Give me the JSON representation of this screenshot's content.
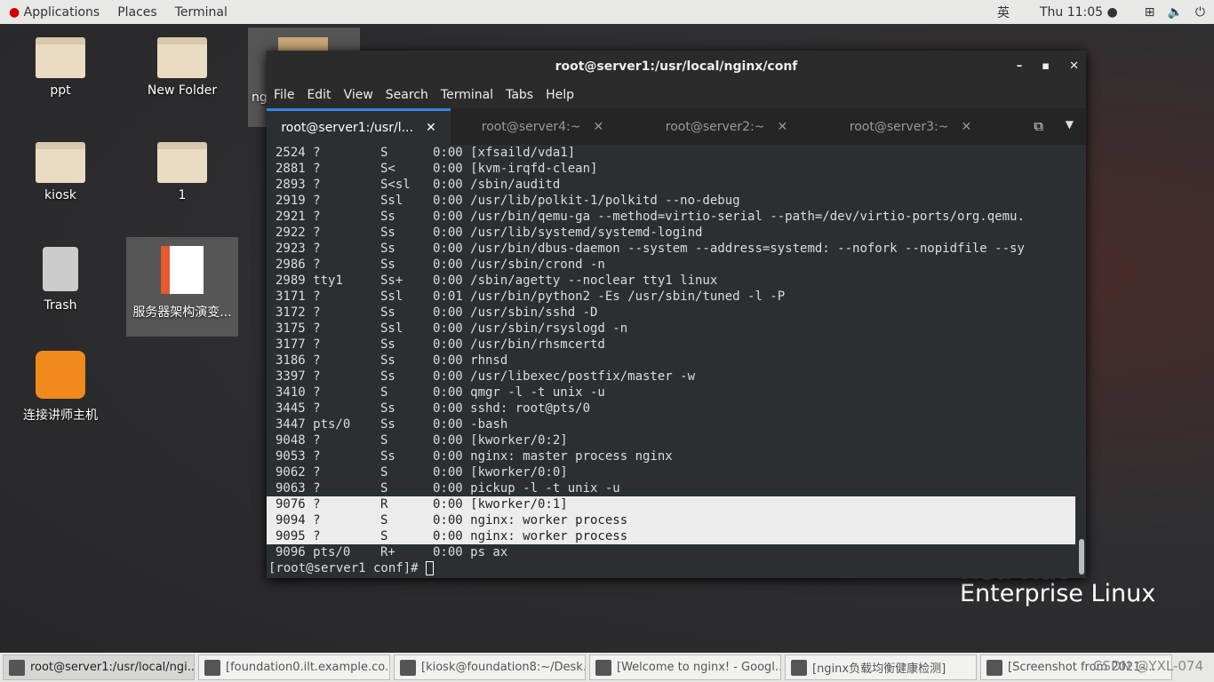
{
  "topbar": {
    "applications": "Applications",
    "places": "Places",
    "terminal": "Terminal",
    "input_method": "英",
    "clock": "Thu 11:05 ●"
  },
  "desktop": [
    {
      "label": "ppt"
    },
    {
      "label": "New Folder"
    },
    {
      "label": "ng"
    },
    {
      "label": "kiosk"
    },
    {
      "label": "1"
    },
    {
      "label": "Trash"
    },
    {
      "label": "服务器架构演变..."
    },
    {
      "label": "连接讲师主机"
    }
  ],
  "terminal": {
    "title": "root@server1:/usr/local/nginx/conf",
    "menu": [
      "File",
      "Edit",
      "View",
      "Search",
      "Terminal",
      "Tabs",
      "Help"
    ],
    "tabs": [
      {
        "label": "root@server1:/usr/l..."
      },
      {
        "label": "root@server4:~"
      },
      {
        "label": "root@server2:~"
      },
      {
        "label": "root@server3:~"
      }
    ],
    "lines": [
      "2524 ?        S      0:00 [xfsaild/vda1]",
      "2881 ?        S<     0:00 [kvm-irqfd-clean]",
      "2893 ?        S<sl   0:00 /sbin/auditd",
      "2919 ?        Ssl    0:00 /usr/lib/polkit-1/polkitd --no-debug",
      "2921 ?        Ss     0:00 /usr/bin/qemu-ga --method=virtio-serial --path=/dev/virtio-ports/org.qemu.",
      "2922 ?        Ss     0:00 /usr/lib/systemd/systemd-logind",
      "2923 ?        Ss     0:00 /usr/bin/dbus-daemon --system --address=systemd: --nofork --nopidfile --sy",
      "2986 ?        Ss     0:00 /usr/sbin/crond -n",
      "2989 tty1     Ss+    0:00 /sbin/agetty --noclear tty1 linux",
      "3171 ?        Ssl    0:01 /usr/bin/python2 -Es /usr/sbin/tuned -l -P",
      "3172 ?        Ss     0:00 /usr/sbin/sshd -D",
      "3175 ?        Ssl    0:00 /usr/sbin/rsyslogd -n",
      "3177 ?        Ss     0:00 /usr/bin/rhsmcertd",
      "3186 ?        Ss     0:00 rhnsd",
      "3397 ?        Ss     0:00 /usr/libexec/postfix/master -w",
      "3410 ?        S      0:00 qmgr -l -t unix -u",
      "3445 ?        Ss     0:00 sshd: root@pts/0",
      "3447 pts/0    Ss     0:00 -bash",
      "9048 ?        S      0:00 [kworker/0:2]",
      "9053 ?        Ss     0:00 nginx: master process nginx",
      "9062 ?        S      0:00 [kworker/0:0]",
      "9063 ?        S      0:00 pickup -l -t unix -u",
      "9076 ?        R      0:00 [kworker/0:1]",
      "9094 ?        S      0:00 nginx: worker process",
      "9095 ?        S      0:00 nginx: worker process",
      "9096 pts/0    R+     0:00 ps ax"
    ],
    "prompt": "[root@server1 conf]# "
  },
  "brand": {
    "line1": "Red Hat",
    "line2": "Enterprise Linux"
  },
  "taskbar": [
    {
      "label": "root@server1:/usr/local/ngi..."
    },
    {
      "label": "[foundation0.ilt.example.co..."
    },
    {
      "label": "[kiosk@foundation8:~/Desk..."
    },
    {
      "label": "[Welcome to nginx! - Googl..."
    },
    {
      "label": "[nginx负载均衡健康检测]"
    },
    {
      "label": "[Screenshot from 2021-..."
    }
  ],
  "watermark": "CSDN @YXL-074"
}
